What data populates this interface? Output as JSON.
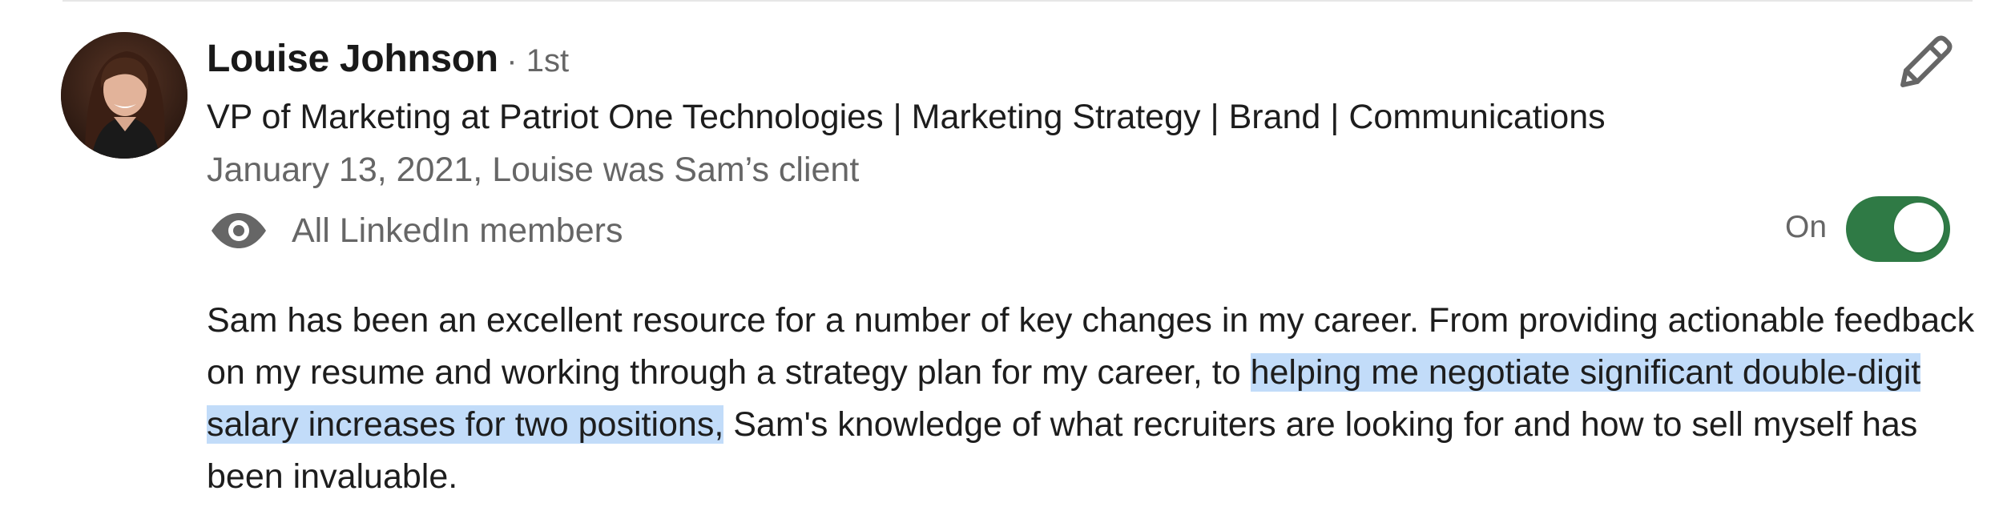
{
  "recommendation": {
    "author_name": "Louise Johnson",
    "connection_degree": "· 1st",
    "headline": "VP of Marketing at Patriot One Technologies | Marketing Strategy | Brand | Communications",
    "relationship": "January 13, 2021, Louise was Sam’s client",
    "visibility": {
      "icon": "eye-icon",
      "label": "All LinkedIn members"
    },
    "toggle": {
      "state_label": "On",
      "is_on": true,
      "color": "#2f7a45"
    },
    "edit_icon": "pencil-icon",
    "text": {
      "before_highlight": "Sam has been an excellent resource for a number of key changes in my career. From providing actionable feedback on my resume and working through a strategy plan for my career, to ",
      "highlighted": "helping me negotiate significant double-digit salary increases for two positions,",
      "after_highlight": " Sam's knowledge of what recruiters are looking for and how to sell myself has been invaluable.",
      "highlight_color": "#c2dcf9"
    }
  }
}
